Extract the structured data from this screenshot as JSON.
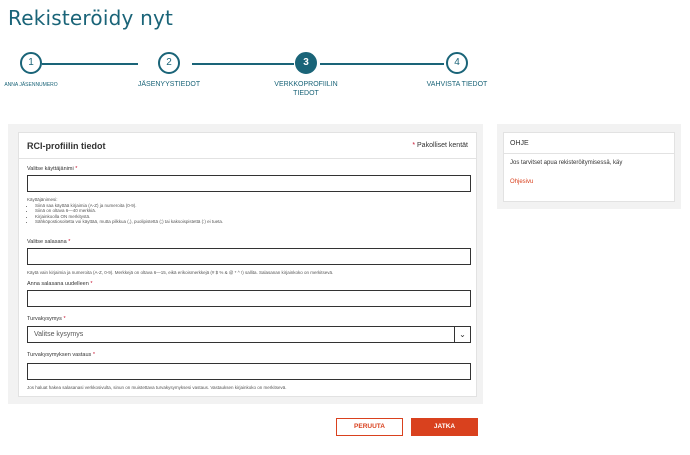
{
  "page": {
    "title": "Rekisteröidy nyt"
  },
  "stepper": {
    "steps": [
      {
        "number": "1",
        "label": "ANNA JÄSENNUMERO"
      },
      {
        "number": "2",
        "label": "JÄSENYYSTIEDOT"
      },
      {
        "number": "3",
        "label": "VERKKOPROFIILIN TIEDOT"
      },
      {
        "number": "4",
        "label": "VAHVISTA TIEDOT"
      }
    ],
    "active_step": 3
  },
  "form": {
    "title": "RCI-profiilin tiedot",
    "required_note_star": "*",
    "required_note": "Pakolliset kentät",
    "username": {
      "label": "Valitse käyttäjänimi",
      "required_star": "*",
      "value": "",
      "help_title": "Käyttäjänimesi:",
      "help_items": [
        "Siinä saa käyttää kirjaimia (A-Z) ja numeroita (0-9).",
        "Siinä on oltava 6—40 merkkiä.",
        "Kirjainkoolla ON merkitystä.",
        "Sähköpostiosoitetta voi käyttää, mutta pilkkua (,), puolipistettä (;) tai kaksoispistettä (:) ei tueta."
      ]
    },
    "password": {
      "label": "Valitse salasana",
      "required_star": "*",
      "value": "",
      "help": "Käytä vain kirjaimia ja numeroita (A-Z, 0-9). Merkkejä on oltava 6—15, eikä erikoismerkkejä (# $ % & @ * ^ !) sallita. Salasanan kirjainkoko on merkitsevä."
    },
    "password_confirm": {
      "label": "Anna salasana uudelleen",
      "required_star": "*",
      "value": ""
    },
    "security_question": {
      "label": "Turvakysymys",
      "required_star": "*",
      "selected": "Valitse kysymys"
    },
    "security_answer": {
      "label": "Turvakysymyksen vastaus",
      "required_star": "*",
      "value": "",
      "help": "Jos haluat hakea salasanasi verkkosivulta, sinun on muistettava turvakysymyksesi vastaus. Vastauksen kirjainkoko on merkitsevä."
    }
  },
  "help_panel": {
    "title": "OHJE",
    "text": "Jos tarvitset apua rekisteröitymisessä, käy",
    "link": "Ohjesivu"
  },
  "actions": {
    "cancel_label": "PERUUTA",
    "next_label": "JATKA"
  },
  "colors": {
    "brand": "#1a6478",
    "accent": "#d9411e",
    "required": "#c8102e"
  }
}
